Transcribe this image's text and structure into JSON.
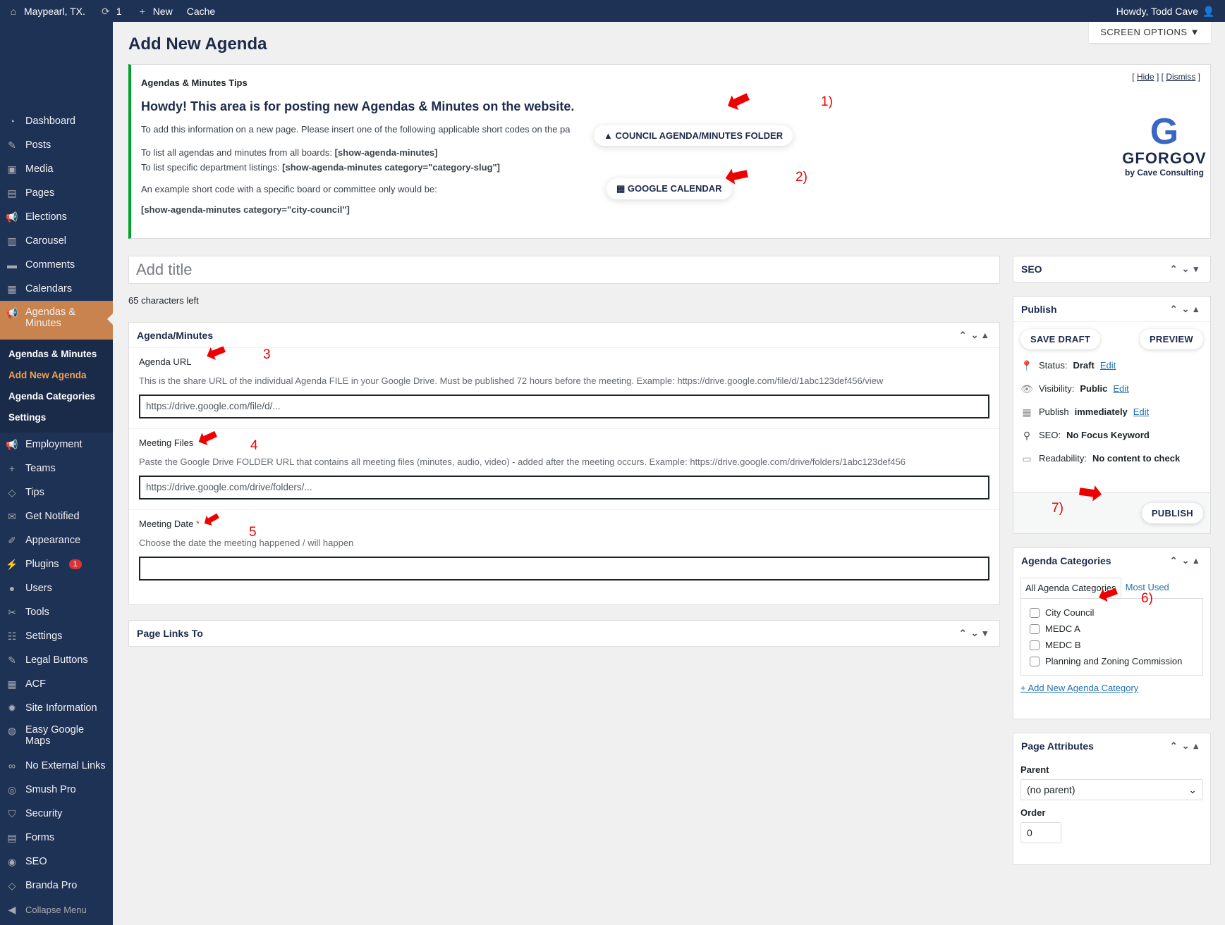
{
  "adminbar": {
    "site_name": "Maypearl, TX.",
    "updates_count": "1",
    "new_label": "New",
    "cache_label": "Cache",
    "howdy": "Howdy, Todd Cave"
  },
  "sidebar": {
    "items": [
      {
        "label": "Dashboard",
        "icon": "dashboard-icon"
      },
      {
        "label": "Posts",
        "icon": "pin-icon"
      },
      {
        "label": "Media",
        "icon": "media-icon"
      },
      {
        "label": "Pages",
        "icon": "pages-icon"
      },
      {
        "label": "Elections",
        "icon": "megaphone-icon"
      },
      {
        "label": "Carousel",
        "icon": "carousel-icon"
      },
      {
        "label": "Comments",
        "icon": "comment-icon"
      },
      {
        "label": "Calendars",
        "icon": "calendar-icon"
      },
      {
        "label": "Agendas & Minutes",
        "icon": "megaphone-icon"
      },
      {
        "label": "Employment",
        "icon": "megaphone-icon"
      },
      {
        "label": "Teams",
        "icon": "plus-icon"
      },
      {
        "label": "Tips",
        "icon": "tag-icon"
      },
      {
        "label": "Get Notified",
        "icon": "mail-icon"
      },
      {
        "label": "Appearance",
        "icon": "brush-icon"
      },
      {
        "label": "Plugins",
        "icon": "plugin-icon",
        "badge": "1"
      },
      {
        "label": "Users",
        "icon": "user-icon"
      },
      {
        "label": "Tools",
        "icon": "wrench-icon"
      },
      {
        "label": "Settings",
        "icon": "settings-icon"
      },
      {
        "label": "Legal Buttons",
        "icon": "edit-icon"
      },
      {
        "label": "ACF",
        "icon": "table-icon"
      },
      {
        "label": "Site Information",
        "icon": "gear-icon"
      },
      {
        "label": "Easy Google Maps",
        "icon": "globe-icon"
      },
      {
        "label": "No External Links",
        "icon": "link-icon"
      },
      {
        "label": "Smush Pro",
        "icon": "smush-icon"
      },
      {
        "label": "Security",
        "icon": "shield-icon"
      },
      {
        "label": "Forms",
        "icon": "forms-icon"
      },
      {
        "label": "SEO",
        "icon": "seo-icon"
      },
      {
        "label": "Branda Pro",
        "icon": "tag-icon"
      }
    ],
    "submenu": [
      "Agendas & Minutes",
      "Add New Agenda",
      "Agenda Categories",
      "Settings"
    ],
    "collapse": "Collapse Menu"
  },
  "page": {
    "title": "Add New Agenda",
    "screen_options": "SCREEN OPTIONS ▼"
  },
  "tips": {
    "heading": "Agendas & Minutes Tips",
    "hide": "Hide",
    "dismiss": "Dismiss",
    "howdy": "Howdy! This area is for posting new Agendas & Minutes on the website.",
    "line1": "To add this information on a new page. Please insert one of the following applicable short codes on the pa",
    "line2_prefix": "To list all agendas and minutes from all boards: ",
    "line2_code": "[show-agenda-minutes]",
    "line3_prefix": "To list specific department listings: ",
    "line3_code": "[show-agenda-minutes category=\"category-slug\"]",
    "line4": "An example short code with a specific board or committee only would be:",
    "line5": "[show-agenda-minutes category=\"city-council\"]",
    "btn_folder": "COUNCIL AGENDA/MINUTES FOLDER",
    "btn_calendar": "GOOGLE CALENDAR",
    "logo_name": "GFORGOV",
    "logo_sub": "by Cave Consulting"
  },
  "annotations": [
    "1)",
    "2)",
    "3",
    "4",
    "5",
    "6)",
    "7)"
  ],
  "editor": {
    "title_placeholder": "Add title",
    "chars_left": "65 characters left"
  },
  "agenda_box": {
    "title": "Agenda/Minutes",
    "fields": [
      {
        "label": "Agenda URL",
        "desc": "This is the share URL of the individual Agenda FILE in your Google Drive. Must be published 72 hours before the meeting. Example: https://drive.google.com/file/d/1abc123def456/view",
        "placeholder": "https://drive.google.com/file/d/..."
      },
      {
        "label": "Meeting Files",
        "desc": "Paste the Google Drive FOLDER URL that contains all meeting files (minutes, audio, video) - added after the meeting occurs. Example: https://drive.google.com/drive/folders/1abc123def456",
        "placeholder": "https://drive.google.com/drive/folders/..."
      },
      {
        "label": "Meeting Date",
        "required": "*",
        "desc": "Choose the date the meeting happened / will happen",
        "placeholder": ""
      }
    ]
  },
  "page_links_box": {
    "title": "Page Links To"
  },
  "seo_box": {
    "title": "SEO"
  },
  "publish_box": {
    "title": "Publish",
    "save_draft": "SAVE DRAFT",
    "preview": "PREVIEW",
    "status_label": "Status:",
    "status_value": "Draft",
    "visibility_label": "Visibility:",
    "visibility_value": "Public",
    "publish_label": "Publish",
    "publish_value": "immediately",
    "edit": "Edit",
    "seo_label": "SEO:",
    "seo_value": "No Focus Keyword",
    "readability_label": "Readability:",
    "readability_value": "No content to check",
    "publish_btn": "PUBLISH"
  },
  "categories_box": {
    "title": "Agenda Categories",
    "tab_all": "All Agenda Categories",
    "tab_used": "Most Used",
    "items": [
      "City Council",
      "MEDC A",
      "MEDC B",
      "Planning and Zoning Commission"
    ],
    "add_new": "+ Add New Agenda Category"
  },
  "attributes_box": {
    "title": "Page Attributes",
    "parent_label": "Parent",
    "parent_value": "(no parent)",
    "order_label": "Order",
    "order_value": "0"
  }
}
